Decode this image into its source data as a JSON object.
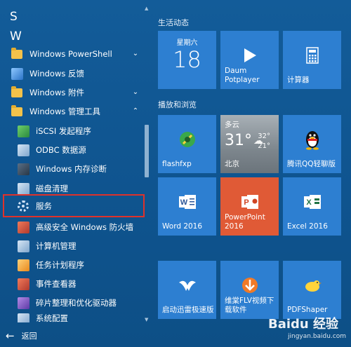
{
  "left_list": {
    "letters": [
      "S",
      "W"
    ],
    "items": [
      {
        "label": "Windows PowerShell",
        "expanded": false
      },
      {
        "label": "Windows 反馈"
      },
      {
        "label": "Windows 附件",
        "expanded": false
      },
      {
        "label": "Windows 管理工具",
        "expanded": true
      },
      {
        "label": "iSCSI 发起程序"
      },
      {
        "label": "ODBC 数据源"
      },
      {
        "label": "Windows 内存诊断"
      },
      {
        "label": "磁盘清理"
      },
      {
        "label": "服务",
        "highlighted": true
      },
      {
        "label": "高级安全 Windows 防火墙"
      },
      {
        "label": "计算机管理"
      },
      {
        "label": "任务计划程序"
      },
      {
        "label": "事件查看器"
      },
      {
        "label": "碎片整理和优化驱动器"
      },
      {
        "label": "系统配置"
      }
    ],
    "back_label": "返回"
  },
  "tiles": {
    "group1_title": "生活动态",
    "group2_title": "播放和浏览",
    "calendar": {
      "weekday": "星期六",
      "day": "18"
    },
    "potplayer": {
      "label_line1": "Daum",
      "label_line2": "Potplayer"
    },
    "calculator": {
      "label": "计算器"
    },
    "flashfxp": {
      "label": "flashfxp"
    },
    "weather": {
      "condition": "多云",
      "temp": "31°",
      "high": "32°",
      "low": "21°",
      "city": "北京"
    },
    "qq": {
      "label": "腾讯QQ轻聊版"
    },
    "word": {
      "label": "Word 2016"
    },
    "powerpoint": {
      "label_line1": "PowerPoint",
      "label_line2": "2016"
    },
    "excel": {
      "label": "Excel 2016"
    },
    "xunlei": {
      "label": "启动迅雷极速版"
    },
    "flv": {
      "label_line1": "维棠FLV视频下",
      "label_line2": "载软件"
    },
    "pdfshaper": {
      "label": "PDFShaper"
    }
  },
  "watermark": {
    "brand": "Baidu 经验",
    "url": "jingyan.baidu.com"
  },
  "colors": {
    "accent_tile": "#2d7fd1",
    "highlight": "#e0322a",
    "ppt": "#e05a36"
  }
}
